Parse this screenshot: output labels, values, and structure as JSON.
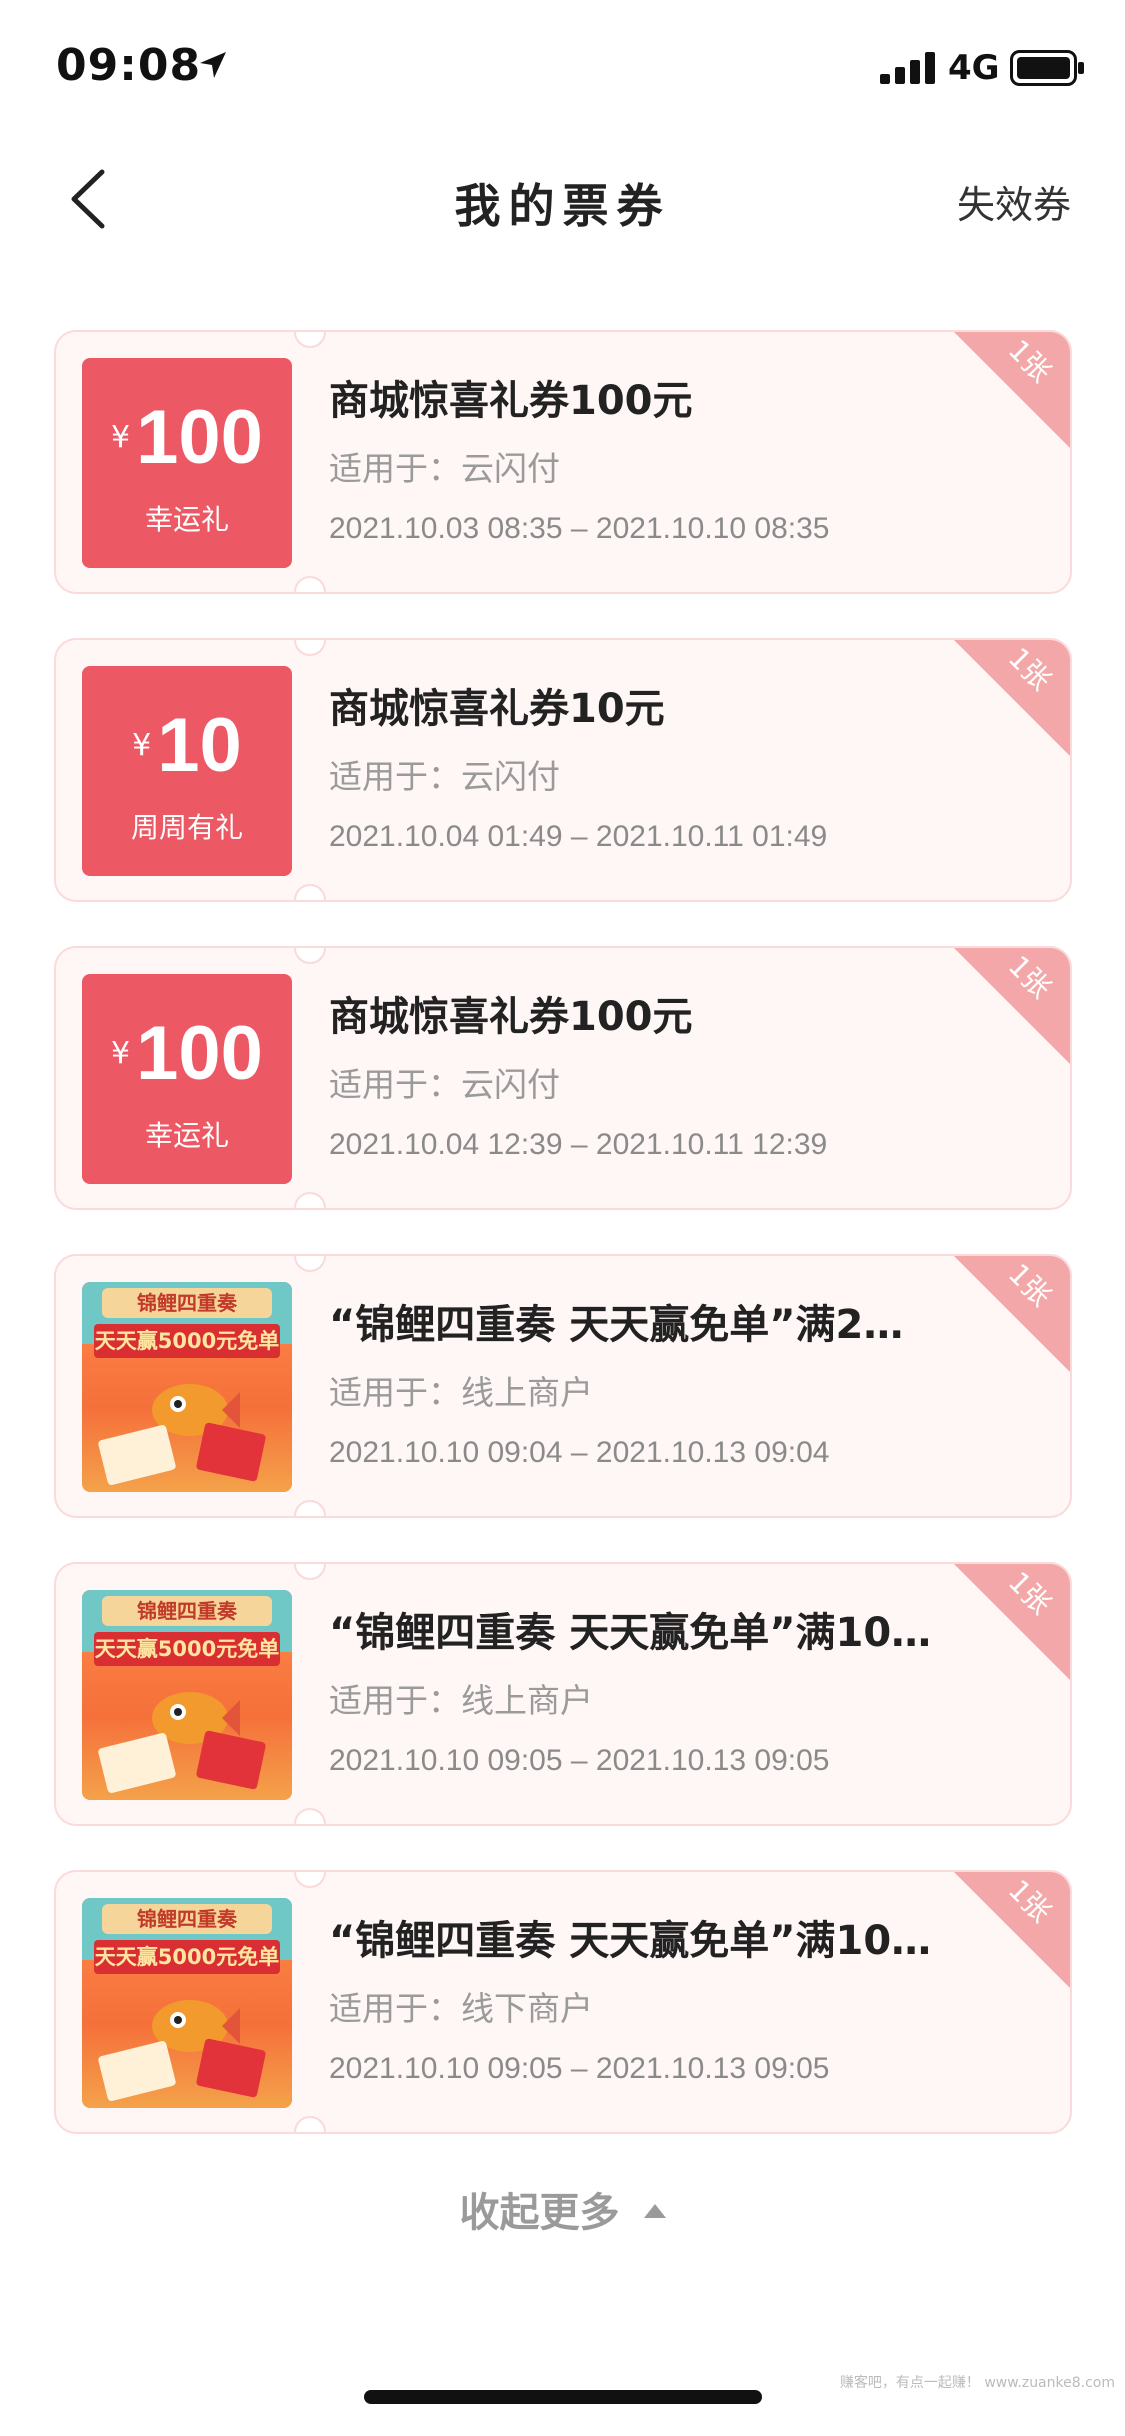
{
  "status_bar": {
    "time": "09:08",
    "network": "4G"
  },
  "nav": {
    "title": "我的票券",
    "right_action": "失效券"
  },
  "coupons": [
    {
      "kind": "value",
      "currency": "¥",
      "amount": "100",
      "subtitle": "幸运礼",
      "title": "商城惊喜礼券100元",
      "scope": "适用于：云闪付",
      "period": "2021.10.03 08:35 – 2021.10.10 08:35",
      "quantity": "1张"
    },
    {
      "kind": "value",
      "currency": "¥",
      "amount": "10",
      "subtitle": "周周有礼",
      "title": "商城惊喜礼券10元",
      "scope": "适用于：云闪付",
      "period": "2021.10.04 01:49 – 2021.10.11 01:49",
      "quantity": "1张"
    },
    {
      "kind": "value",
      "currency": "¥",
      "amount": "100",
      "subtitle": "幸运礼",
      "title": "商城惊喜礼券100元",
      "scope": "适用于：云闪付",
      "period": "2021.10.04 12:39 – 2021.10.11 12:39",
      "quantity": "1张"
    },
    {
      "kind": "promo",
      "thumb_seal": "锦鲤四重奏",
      "thumb_banner": "天天赢5000元免单",
      "title": "“锦鲤四重奏 天天赢免单”满2…",
      "scope": "适用于：线上商户",
      "period": "2021.10.10 09:04 – 2021.10.13 09:04",
      "quantity": "1张"
    },
    {
      "kind": "promo",
      "thumb_seal": "锦鲤四重奏",
      "thumb_banner": "天天赢5000元免单",
      "title": "“锦鲤四重奏 天天赢免单”满10…",
      "scope": "适用于：线上商户",
      "period": "2021.10.10 09:05 – 2021.10.13 09:05",
      "quantity": "1张"
    },
    {
      "kind": "promo",
      "thumb_seal": "锦鲤四重奏",
      "thumb_banner": "天天赢5000元免单",
      "title": "“锦鲤四重奏 天天赢免单”满10…",
      "scope": "适用于：线下商户",
      "period": "2021.10.10 09:05 – 2021.10.13 09:05",
      "quantity": "1张"
    }
  ],
  "footer": {
    "collapse_label": "收起更多",
    "watermark": "赚客吧，有点一起赚！ www.zuanke8.com"
  },
  "colors": {
    "accent_red": "#ec5864",
    "card_bg": "#fff6f6",
    "card_border": "#fadada",
    "badge": "#f3a7a9"
  }
}
